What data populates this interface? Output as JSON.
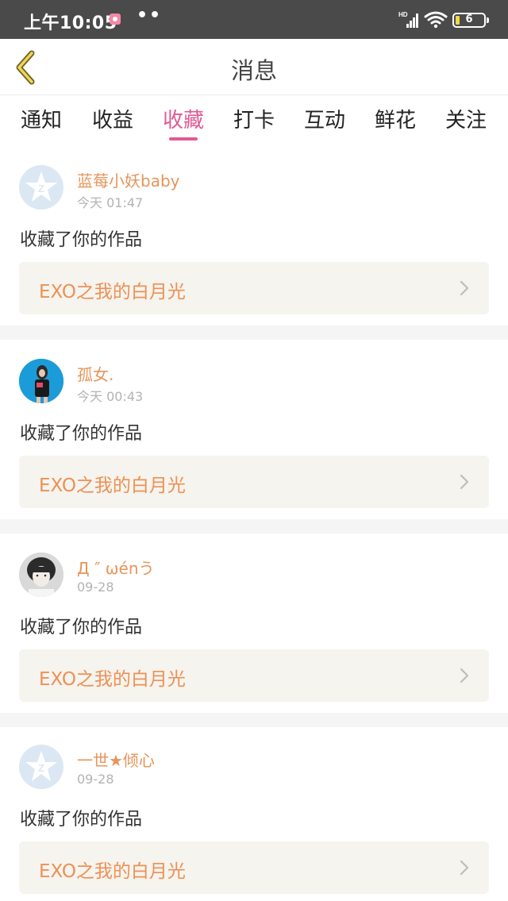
{
  "status_bar": {
    "time": "上午10:05",
    "dots": "••",
    "network": "HD",
    "battery": "6"
  },
  "nav": {
    "title": "消息"
  },
  "tabs": [
    {
      "label": "通知",
      "active": false
    },
    {
      "label": "收益",
      "active": false
    },
    {
      "label": "收藏",
      "active": true
    },
    {
      "label": "打卡",
      "active": false
    },
    {
      "label": "互动",
      "active": false
    },
    {
      "label": "鲜花",
      "active": false
    },
    {
      "label": "关注",
      "active": false
    }
  ],
  "colors": {
    "accent": "#e05a94",
    "username": "#e7955a",
    "work_title": "#ee9055",
    "work_box_bg": "#f5f4ee"
  },
  "messages": [
    {
      "username": "蓝莓小妖baby",
      "time": "今天 01:47",
      "action": "收藏了你的作品",
      "work": "EXO之我的白月光",
      "avatar": "default-avatar"
    },
    {
      "username": "孤女.",
      "time": "今天 00:43",
      "action": "收藏了你的作品",
      "work": "EXO之我的白月光",
      "avatar": "photo-avatar"
    },
    {
      "username": "Д ″ ωénう",
      "time": "09-28",
      "action": "收藏了你的作品",
      "work": "EXO之我的白月光",
      "avatar": "photo-avatar"
    },
    {
      "username": "一世★倾心",
      "time": "09-28",
      "action": "收藏了你的作品",
      "work": "EXO之我的白月光",
      "avatar": "default-avatar"
    }
  ]
}
